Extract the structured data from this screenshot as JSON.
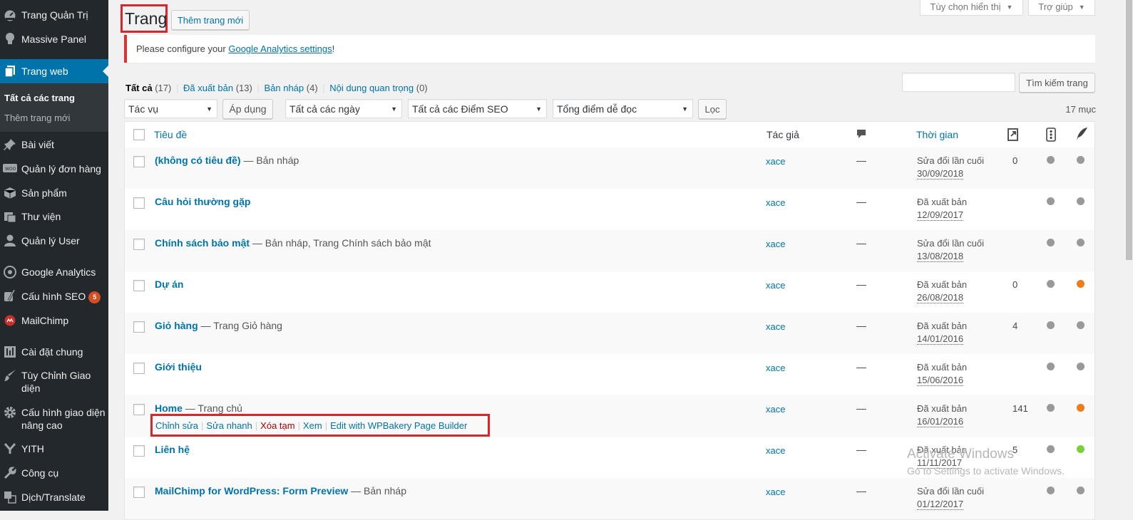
{
  "sidebar": {
    "items": [
      {
        "label": "Trang Quản Trị",
        "icon": "dashboard-icon"
      },
      {
        "label": "Massive Panel",
        "icon": "lightbulb-icon"
      },
      {
        "label": "Trang web",
        "icon": "pages-icon",
        "active": true
      },
      {
        "label": "Bài viết",
        "icon": "pin-icon"
      },
      {
        "label": "Quản lý đơn hàng",
        "icon": "woo-icon"
      },
      {
        "label": "Sản phẩm",
        "icon": "box-icon"
      },
      {
        "label": "Thư viện",
        "icon": "media-icon"
      },
      {
        "label": "Quản lý User",
        "icon": "user-icon"
      },
      {
        "label": "Google Analytics",
        "icon": "analytics-icon"
      },
      {
        "label": "Cấu hình SEO",
        "icon": "yoast-icon",
        "badge": "5"
      },
      {
        "label": "MailChimp",
        "icon": "mailchimp-icon"
      },
      {
        "label": "Cài đặt chung",
        "icon": "settings-icon"
      },
      {
        "label": "Tùy Chỉnh Giao diện",
        "icon": "brush-icon"
      },
      {
        "label": "Cấu hình giao diện nâng cao",
        "icon": "gear-icon"
      },
      {
        "label": "YITH",
        "icon": "yith-icon"
      },
      {
        "label": "Công cụ",
        "icon": "wrench-icon"
      },
      {
        "label": "Dịch/Translate",
        "icon": "translate-icon"
      }
    ],
    "submenu": [
      "Tất cả các trang",
      "Thêm trang mới"
    ]
  },
  "header": {
    "title": "Trang",
    "add_new": "Thêm trang mới",
    "screen_options": "Tùy chọn hiển thị",
    "help": "Trợ giúp"
  },
  "notice": {
    "prefix": "Please configure your ",
    "link": "Google Analytics settings",
    "suffix": "!"
  },
  "views": [
    {
      "label": "Tất cả",
      "count": "(17)"
    },
    {
      "label": "Đã xuất bản",
      "count": "(13)"
    },
    {
      "label": "Bản nháp",
      "count": "(4)"
    },
    {
      "label": "Nội dung quan trọng",
      "count": "(0)"
    }
  ],
  "search": {
    "button": "Tìm kiếm trang",
    "value": ""
  },
  "filters": {
    "bulk_action": "Tác vụ",
    "apply": "Áp dụng",
    "dates": "Tất cả các ngày",
    "seo": "Tất cả các Điểm SEO",
    "readability": "Tổng điểm dễ đọc",
    "filter": "Lọc",
    "item_count": "17 mục"
  },
  "table": {
    "columns": {
      "title": "Tiêu đề",
      "author": "Tác giả",
      "date": "Thời gian"
    },
    "rows": [
      {
        "title": "(không có tiêu đề)",
        "state": " — Bản nháp",
        "author": "xace",
        "comments": "—",
        "date_status": "Sửa đổi lần cuối",
        "date": "30/09/2018",
        "links": "0",
        "seo": "#999999",
        "read": "#999999"
      },
      {
        "title": "Câu hỏi thường gặp",
        "state": "",
        "author": "xace",
        "comments": "—",
        "date_status": "Đã xuất bản",
        "date": "12/09/2017",
        "links": "",
        "seo": "#999999",
        "read": "#999999"
      },
      {
        "title": "Chính sách bảo mật",
        "state": " — Bản nháp, Trang Chính sách bảo mật",
        "author": "xace",
        "comments": "—",
        "date_status": "Sửa đổi lần cuối",
        "date": "13/08/2018",
        "links": "",
        "seo": "#999999",
        "read": "#999999"
      },
      {
        "title": "Dự án",
        "state": "",
        "author": "xace",
        "comments": "—",
        "date_status": "Đã xuất bản",
        "date": "26/08/2018",
        "links": "0",
        "seo": "#999999",
        "read": "#ee7c1b"
      },
      {
        "title": "Giỏ hàng",
        "state": " — Trang Giỏ hàng",
        "author": "xace",
        "comments": "—",
        "date_status": "Đã xuất bản",
        "date": "14/01/2016",
        "links": "4",
        "seo": "#999999",
        "read": "#999999"
      },
      {
        "title": "Giới thiệu",
        "state": "",
        "author": "xace",
        "comments": "—",
        "date_status": "Đã xuất bản",
        "date": "15/06/2016",
        "links": "",
        "seo": "#999999",
        "read": "#999999"
      },
      {
        "title": "Home",
        "state": " — Trang chủ",
        "author": "xace",
        "comments": "—",
        "date_status": "Đã xuất bản",
        "date": "16/01/2016",
        "links": "141",
        "seo": "#999999",
        "read": "#ee7c1b"
      },
      {
        "title": "Liên hệ",
        "state": "",
        "author": "xace",
        "comments": "—",
        "date_status": "Đã xuất bản",
        "date": "11/11/2017",
        "links": "5",
        "seo": "#999999",
        "read": "#7ad03a"
      },
      {
        "title": "MailChimp for WordPress: Form Preview",
        "state": " — Bản nháp",
        "author": "xace",
        "comments": "—",
        "date_status": "Sửa đổi lần cuối",
        "date": "01/12/2017",
        "links": "",
        "seo": "#999999",
        "read": "#999999"
      }
    ],
    "row_actions": [
      "Chỉnh sửa",
      "Sửa nhanh",
      "Xóa tạm",
      "Xem",
      "Edit with WPBakery Page Builder"
    ]
  },
  "watermark": {
    "line1": "Activate Windows",
    "line2": "Go to Settings to activate Windows."
  },
  "colors": {
    "sidebar_bg": "#23282d",
    "accent": "#0073aa",
    "highlight_box": "#d9262b",
    "notice_border": "#dc3232"
  }
}
